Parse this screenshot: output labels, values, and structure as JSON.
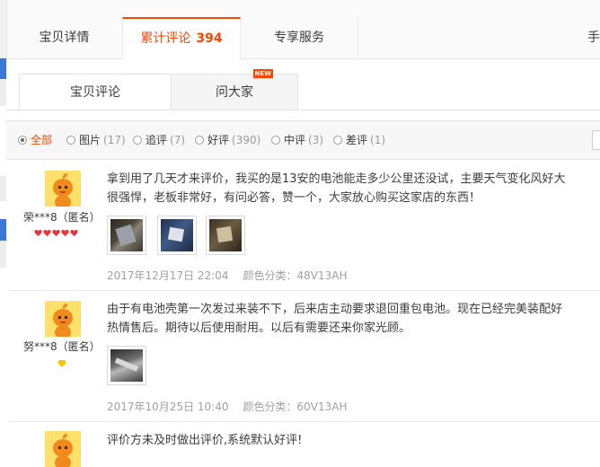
{
  "top_tabs": [
    {
      "label": "宝贝详情"
    },
    {
      "label": "累计评论",
      "count": "394"
    },
    {
      "label": "专享服务"
    },
    {
      "label": "手"
    }
  ],
  "sub_tabs": [
    {
      "label": "宝贝评论"
    },
    {
      "label": "问大家",
      "badge": "NEW"
    }
  ],
  "filters": [
    {
      "label": "全部",
      "count": ""
    },
    {
      "label": "图片",
      "count": "(17)"
    },
    {
      "label": "追评",
      "count": "(7)"
    },
    {
      "label": "好评",
      "count": "(390)"
    },
    {
      "label": "中评",
      "count": "(3)"
    },
    {
      "label": "差评",
      "count": "(1)"
    }
  ],
  "reviews": [
    {
      "username": "荣***8（匿名）",
      "text_lines": [
        "拿到用了几天才来评价，我买的是13安的电池能走多少公里还没试，主要天气变化风好大",
        "很强悍，老板非常好，有问必答，赞一个，大家放心购买这家店的东西！"
      ],
      "photo_count": 3,
      "date": "2017年12月17日 22:04",
      "sku": "颜色分类：48V13AH"
    },
    {
      "username": "努***8（匿名）",
      "text_lines": [
        "由于有电池壳第一次发过来装不下，后来店主动要求退回重包电池。现在已经完美装配好",
        "热情售后。期待以后使用耐用。以后有需要还来你家光顾。"
      ],
      "photo_count": 1,
      "date": "2017年10月25日 10:40",
      "sku": "颜色分类：60V13AH"
    },
    {
      "text_lines": [
        "评价方未及时做出评价,系统默认好评!"
      ]
    }
  ],
  "colors": {
    "accent": "#ff4400",
    "border": "#e8e8e8",
    "avatar_bg": "#ffe06a",
    "avatar_orange": "#f08a1c",
    "heart_red": "#e8363f",
    "diamond_gold": "#f5c400"
  }
}
